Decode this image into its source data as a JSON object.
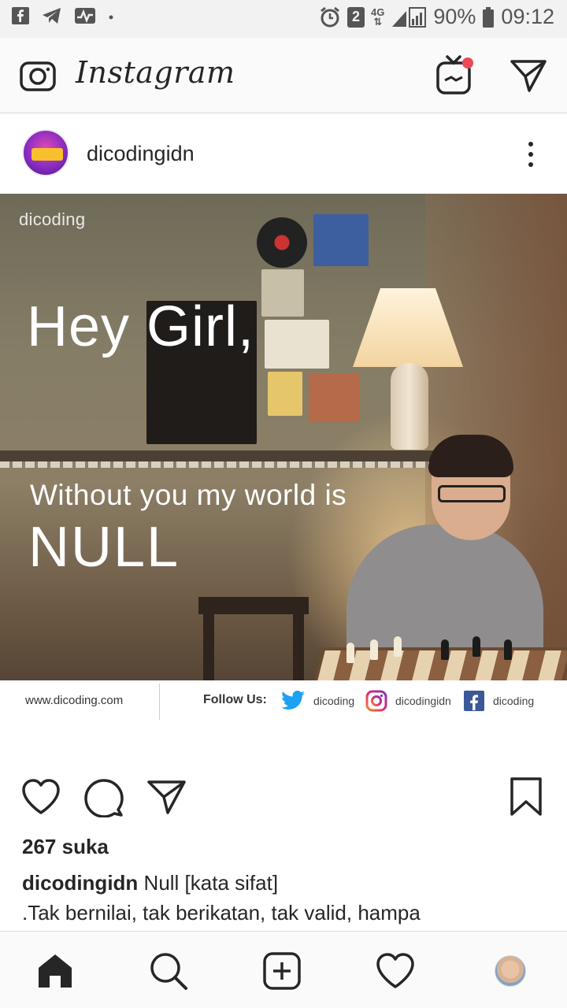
{
  "status_bar": {
    "battery": "90%",
    "time": "09:12",
    "sim_badge": "2",
    "network": "4G",
    "icons": [
      "facebook-icon",
      "telegram-icon",
      "activity-icon",
      "dot-icon",
      "alarm-icon",
      "signal-icon",
      "battery-icon"
    ]
  },
  "app_header": {
    "logo": "Instagram",
    "icons": [
      "camera-icon",
      "igtv-icon",
      "direct-message-icon"
    ],
    "notification_dot_color": "#ed4956"
  },
  "post": {
    "username": "dicodingidn",
    "image": {
      "brand": "dicoding",
      "title": "Hey Girl,",
      "subtitle": "Without you my world is",
      "highlight": "NULL",
      "footer": {
        "url": "www.dicoding.com",
        "follow_label": "Follow Us:",
        "twitter_handle": "dicoding",
        "instagram_handle": "dicodingidn",
        "facebook_handle": "dicoding"
      }
    },
    "likes": "267 suka",
    "caption_user": "dicodingidn",
    "caption_line1": "Null [kata sifat]",
    "caption_line2": ".Tak bernilai, tak berikatan, tak valid, hampa"
  },
  "bottom_nav": {
    "items": [
      "home-icon",
      "search-icon",
      "new-post-icon",
      "activity-heart-icon",
      "profile-avatar"
    ]
  },
  "colors": {
    "text": "#262626",
    "border": "#dbdbdb",
    "twitter": "#1da1f2",
    "facebook": "#3b5998"
  }
}
